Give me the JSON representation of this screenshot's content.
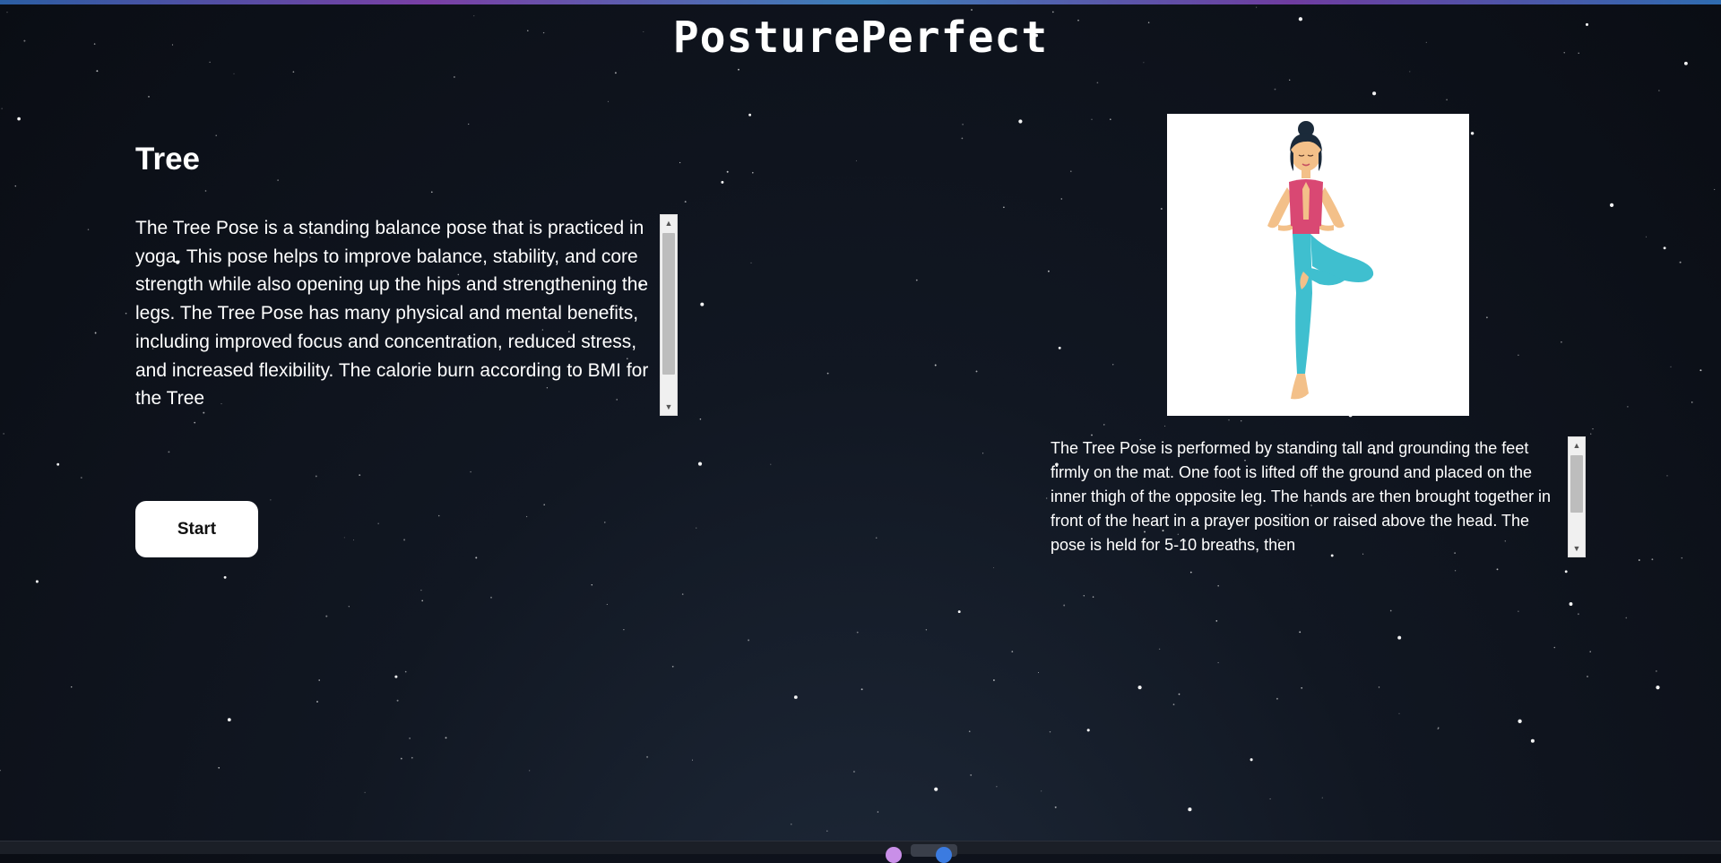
{
  "app": {
    "title": "PosturePerfect"
  },
  "pose": {
    "name": "Tree",
    "description": "The Tree Pose is a standing balance pose that is practiced in yoga. This pose helps to improve balance, stability, and core strength while also opening up the hips and strengthening the legs. The Tree Pose has many physical and mental benefits, including improved focus and concentration, reduced stress, and increased flexibility. The calorie burn according to BMI for the Tree",
    "instructions": "The Tree Pose is performed by standing tall and grounding the feet firmly on the mat. One foot is lifted off the ground and placed on the inner thigh of the opposite leg. The hands are then brought together in front of the heart in a prayer position or raised above the head. The pose is held for 5-10 breaths, then",
    "image_icon": "woman-tree-pose-illustration"
  },
  "actions": {
    "start_label": "Start"
  },
  "scroll": {
    "up_arrow": "▲",
    "down_arrow": "▼"
  },
  "colors": {
    "background": "#111722",
    "button_bg": "#ffffff",
    "button_text": "#111111",
    "text": "#ffffff",
    "leggings": "#3fbfcf",
    "top": "#d94873"
  }
}
